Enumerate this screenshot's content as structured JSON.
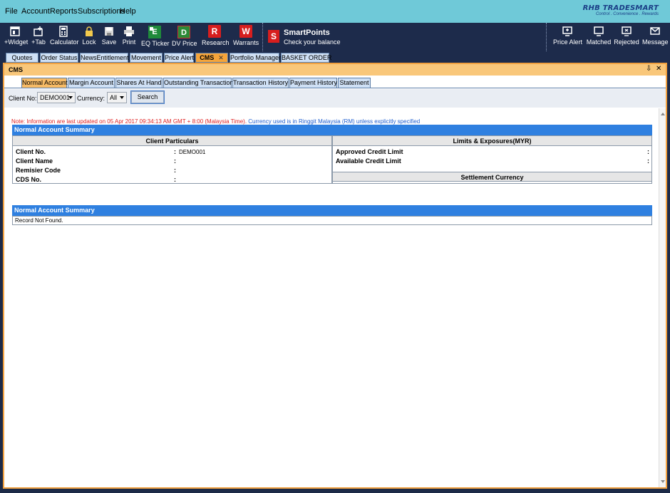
{
  "menu": [
    "File",
    "Account",
    "Reports",
    "Subscriptions",
    "Help"
  ],
  "brand": {
    "name": "RHB TRADESMART",
    "tagline": "Control . Convenience . Rewards"
  },
  "toolbar": {
    "widget": "+Widget",
    "tab": "+Tab",
    "calculator": "Calculator",
    "lock": "Lock",
    "save": "Save",
    "print": "Print",
    "eq_ticker": "EQ Ticker",
    "eq_ticker_letter": "E",
    "dv_price": "DV Price",
    "dv_price_letter": "D",
    "research": "Research",
    "research_letter": "R",
    "warrants": "Warrants",
    "warrants_letter": "W",
    "smartpoints_logo": "S",
    "smartpoints_title": "SmartPoints",
    "smartpoints_sub": "Check your balance",
    "price_alert": "Price Alert",
    "matched": "Matched",
    "rejected": "Rejected",
    "message": "Message"
  },
  "tabs": {
    "quotes": "Quotes",
    "order_status": "Order Status",
    "news": "NewsEntitlement",
    "movement": "Movement",
    "price_alert": "Price Alert",
    "cms": "CMS",
    "portfolio": "Portfolio Manager",
    "basket": "BASKET ORDER"
  },
  "panel": {
    "title": "CMS",
    "pin": "⇩",
    "close": "✕"
  },
  "subtabs": {
    "normal": "Normal Account",
    "margin": "Margin Account",
    "shares": "Shares At Hand",
    "outstanding": "Outstanding Transaction",
    "history": "Transaction History",
    "payment": "Payment History",
    "statement": "Statement"
  },
  "filter": {
    "client_no_label": "Client No:",
    "client_no_value": "DEMO001",
    "currency_label": "Currency:",
    "currency_value": "All",
    "search": "Search"
  },
  "note": {
    "red": "Note: Information are last updated on 05 Apr 2017 09:34:13 AM GMT + 8:00 (Malaysia Time).",
    "blue": "Currency used is in Ringgit Malaysia (RM) unless explicitly specified"
  },
  "summary1": {
    "header": "Normal Account Summary",
    "client_particulars": "Client Particulars",
    "limits": "Limits & Exposures(MYR)",
    "client_no_label": "Client No.",
    "client_no_value": "DEMO001",
    "client_name_label": "Client Name",
    "remisier_label": "Remisier Code",
    "cds_label": "CDS No.",
    "approved_label": "Approved Credit Limit",
    "available_label": "Available Credit Limit",
    "settlement": "Settlement Currency",
    "colon": ":"
  },
  "summary2": {
    "header": "Normal Account Summary",
    "empty": "Record Not Found."
  }
}
